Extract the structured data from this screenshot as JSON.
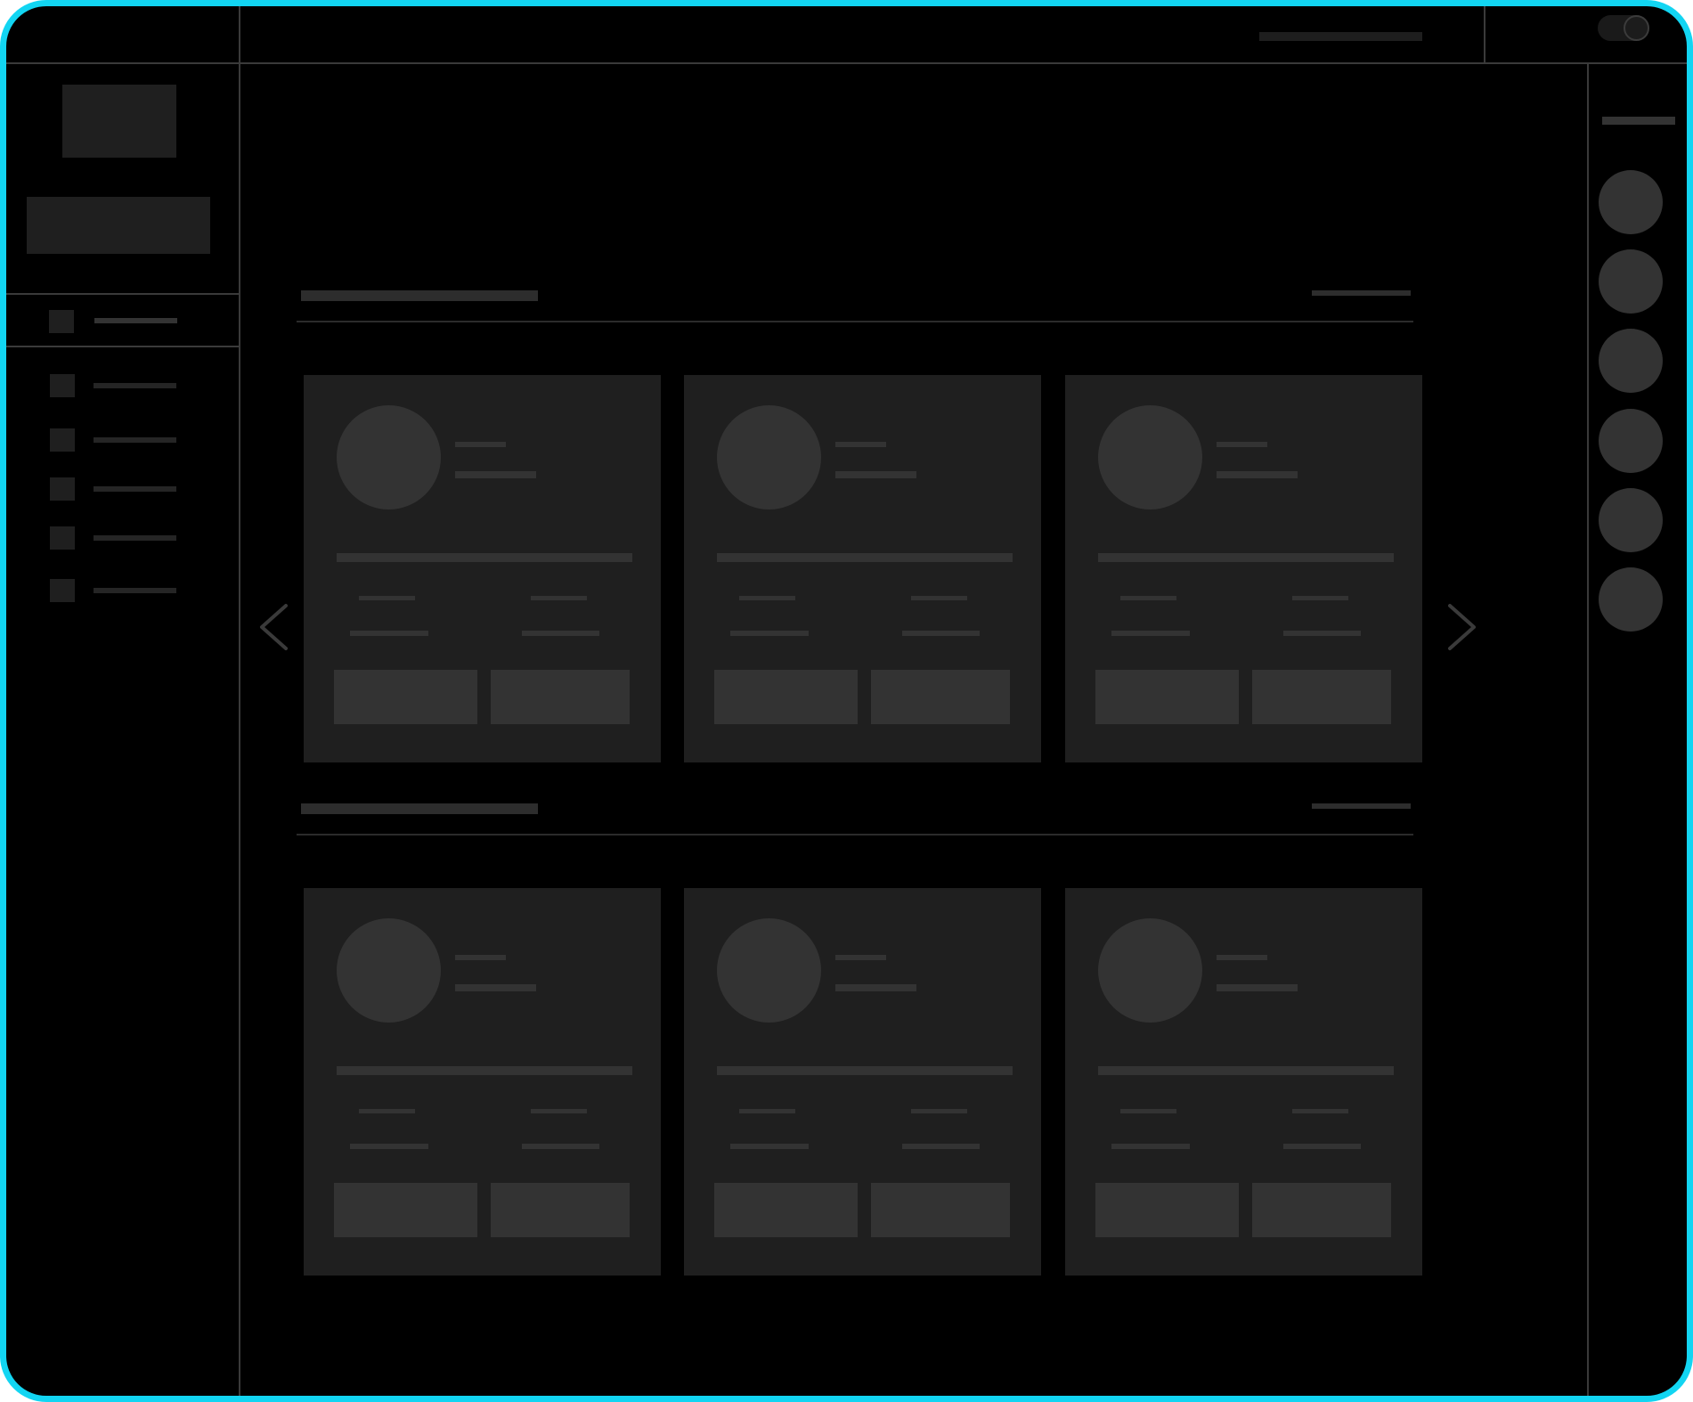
{
  "colors": {
    "accent_border": "#12d5f2",
    "background": "#000000",
    "panel": "#1f1f1f",
    "placeholder": "#333333",
    "divider": "#3a3a3a"
  },
  "header": {
    "search_placeholder": "",
    "theme_toggle": {
      "state": "on"
    }
  },
  "sidebar": {
    "logo": "",
    "primary_button_label": "",
    "active_item": {
      "label": "",
      "icon": "placeholder-icon"
    },
    "items": [
      {
        "label": "",
        "icon": "placeholder-icon"
      },
      {
        "label": "",
        "icon": "placeholder-icon"
      },
      {
        "label": "",
        "icon": "placeholder-icon"
      },
      {
        "label": "",
        "icon": "placeholder-icon"
      },
      {
        "label": "",
        "icon": "placeholder-icon"
      }
    ]
  },
  "main": {
    "sections": [
      {
        "title": "",
        "link_label": "",
        "cards": [
          {
            "name": "",
            "subtitle": "",
            "description": "",
            "stat1_label": "",
            "stat1_value": "",
            "stat2_label": "",
            "stat2_value": "",
            "primary_action": "",
            "secondary_action": ""
          },
          {
            "name": "",
            "subtitle": "",
            "description": "",
            "stat1_label": "",
            "stat1_value": "",
            "stat2_label": "",
            "stat2_value": "",
            "primary_action": "",
            "secondary_action": ""
          },
          {
            "name": "",
            "subtitle": "",
            "description": "",
            "stat1_label": "",
            "stat1_value": "",
            "stat2_label": "",
            "stat2_value": "",
            "primary_action": "",
            "secondary_action": ""
          }
        ]
      },
      {
        "title": "",
        "link_label": "",
        "cards": [
          {
            "name": "",
            "subtitle": "",
            "description": "",
            "stat1_label": "",
            "stat1_value": "",
            "stat2_label": "",
            "stat2_value": "",
            "primary_action": "",
            "secondary_action": ""
          },
          {
            "name": "",
            "subtitle": "",
            "description": "",
            "stat1_label": "",
            "stat1_value": "",
            "stat2_label": "",
            "stat2_value": "",
            "primary_action": "",
            "secondary_action": ""
          },
          {
            "name": "",
            "subtitle": "",
            "description": "",
            "stat1_label": "",
            "stat1_value": "",
            "stat2_label": "",
            "stat2_value": "",
            "primary_action": "",
            "secondary_action": ""
          }
        ]
      }
    ],
    "carousel": {
      "prev_icon": "chevron-left-icon",
      "next_icon": "chevron-right-icon"
    }
  },
  "right_rail": {
    "title": "",
    "avatars": [
      {
        "name": ""
      },
      {
        "name": ""
      },
      {
        "name": ""
      },
      {
        "name": ""
      },
      {
        "name": ""
      },
      {
        "name": ""
      }
    ]
  }
}
